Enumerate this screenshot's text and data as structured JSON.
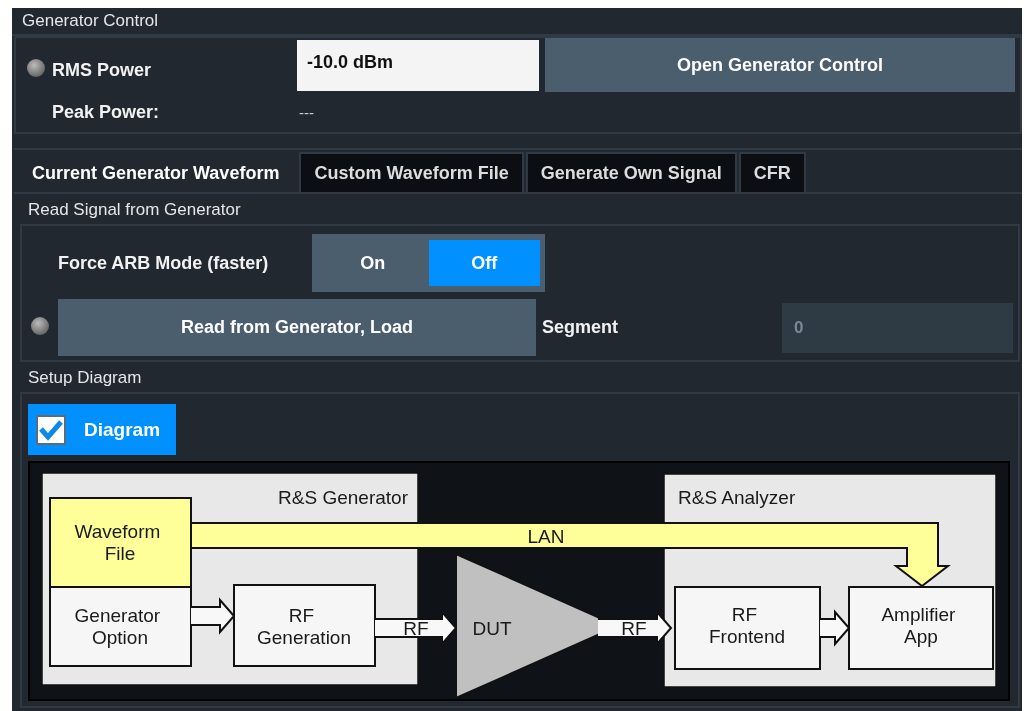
{
  "title": "Generator Control",
  "power": {
    "rms_label": "RMS Power",
    "rms_value": "-10.0 dBm",
    "open_button": "Open Generator Control",
    "peak_label": "Peak Power:",
    "peak_value": "---"
  },
  "tabs": [
    {
      "label": "Current Generator Waveform",
      "selected": true
    },
    {
      "label": "Custom Waveform File",
      "selected": false
    },
    {
      "label": "Generate Own Signal",
      "selected": false
    },
    {
      "label": "CFR",
      "selected": false
    }
  ],
  "read_signal": {
    "title": "Read Signal from Generator",
    "force_arb": {
      "label": "Force ARB Mode (faster)",
      "options": [
        {
          "label": "On",
          "selected": false
        },
        {
          "label": "Off",
          "selected": true
        }
      ]
    },
    "read_button": "Read from Generator, Load",
    "segment": {
      "label": "Segment",
      "value": "0",
      "disabled": true
    }
  },
  "setup": {
    "title": "Setup Diagram",
    "diagram_checkbox": {
      "label": "Diagram",
      "checked": true
    },
    "diagram": {
      "generator_title": "R&S Generator",
      "analyzer_title": "R&S Analyzer",
      "waveform_file": "Waveform File",
      "generator_option": "Generator Option",
      "rf_generation": "RF Generation",
      "rf_out": "RF",
      "dut": "DUT",
      "rf_in": "RF",
      "lan": "LAN",
      "rf_frontend": "RF Frontend",
      "amplifier_app": "Amplifier App"
    }
  }
}
